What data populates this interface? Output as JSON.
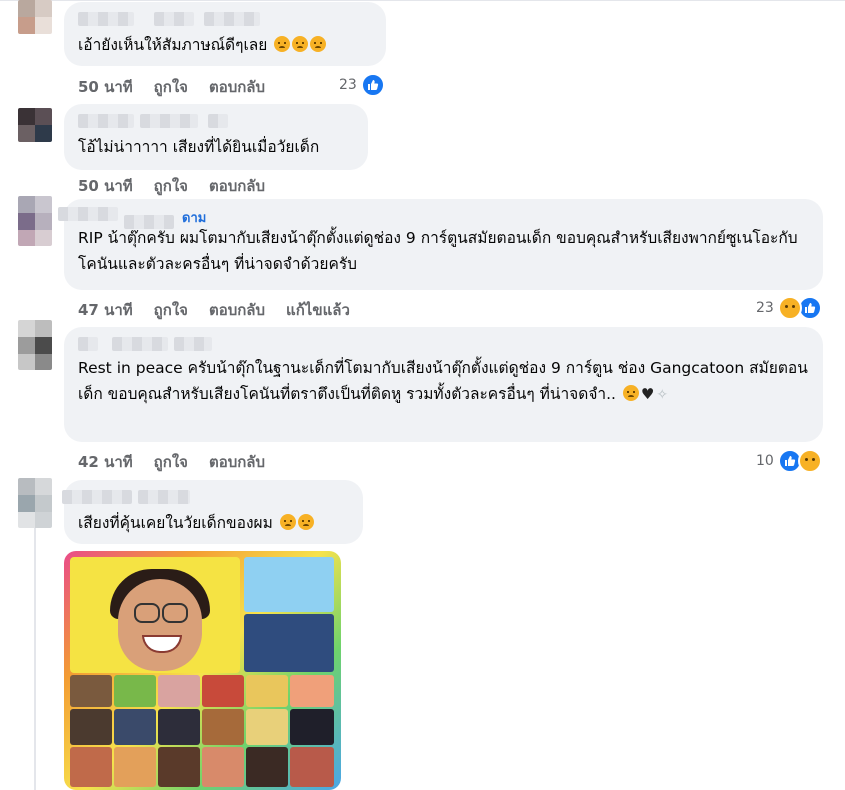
{
  "comments": [
    {
      "text": "เอ้ายังเห็นให้สัมภาษณ์ดีๆเลย",
      "emojis": [
        "sad-face",
        "sad-face",
        "sad-face"
      ],
      "time": "50 นาที",
      "like": "ถูกใจ",
      "reply": "ตอบกลับ",
      "reaction_count": "23",
      "reactions": [
        "like"
      ]
    },
    {
      "text": "โอ้ไม่น่าาาาา เสียงที่ได้ยินเมื่อวัยเด็ก",
      "time": "50 นาที",
      "like": "ถูกใจ",
      "reply": "ตอบกลับ"
    },
    {
      "follow_label": "ดาม",
      "text": "RIP น้าตุ๊กครับ ผมโตมากับเสียงน้าตุ๊กตั้งแต่ดูช่อง 9 การ์ตูนสมัยตอนเด็ก ขอบคุณสำหรับเสียงพากย์ซูเนโอะกับโคนันและตัวละครอื่นๆ ที่น่าจดจำด้วยครับ",
      "time": "47 นาที",
      "like": "ถูกใจ",
      "reply": "ตอบกลับ",
      "edited": "แก้ไขแล้ว",
      "reaction_count": "23",
      "reactions": [
        "sad",
        "like"
      ]
    },
    {
      "text": "Rest in peace ครับน้าตุ๊กในฐานะเด็กที่โตมากับเสียงน้าตุ๊กตั้งแต่ดูช่อง 9 การ์ตูน ช่อง Gangcatoon สมัยตอนเด็ก ขอบคุณสำหรับเสียงโคนันที่ตราตึงเป็นที่ติดหู รวมทั้งตัวละครอื่นๆ ที่น่าจดจำ..",
      "emojis": [
        "pensive-face",
        "black-heart",
        "dove"
      ],
      "time": "42 นาที",
      "like": "ถูกใจ",
      "reply": "ตอบกลับ",
      "reaction_count": "10",
      "reactions": [
        "like",
        "sad"
      ]
    },
    {
      "text": "เสียงที่คุ้นเคยในวัยเด็กของผม",
      "emojis": [
        "sad-tear-face",
        "crying-face"
      ]
    }
  ],
  "colors": {
    "bubble": "#f0f2f5",
    "meta": "#65676b",
    "link": "#216fdb",
    "like": "#1877f2",
    "sad": "#f7b125"
  }
}
